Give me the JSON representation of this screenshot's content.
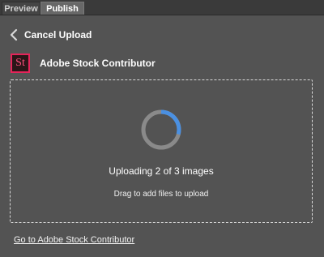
{
  "tabs": {
    "preview": "Preview",
    "publish": "Publish",
    "active": "publish"
  },
  "header": {
    "icon": "chevron-left-icon",
    "title": "Cancel Upload"
  },
  "service": {
    "logo_text": "St",
    "name": "Adobe Stock Contributor",
    "brand_color": "#e5245a"
  },
  "dropzone": {
    "status": "Uploading 2 of 3 images",
    "hint": "Drag to add files to upload",
    "spinner_icon": "progress-spinner-icon",
    "spinner_accent": "#4a90e2"
  },
  "footer": {
    "link": "Go to Adobe Stock Contributor"
  }
}
